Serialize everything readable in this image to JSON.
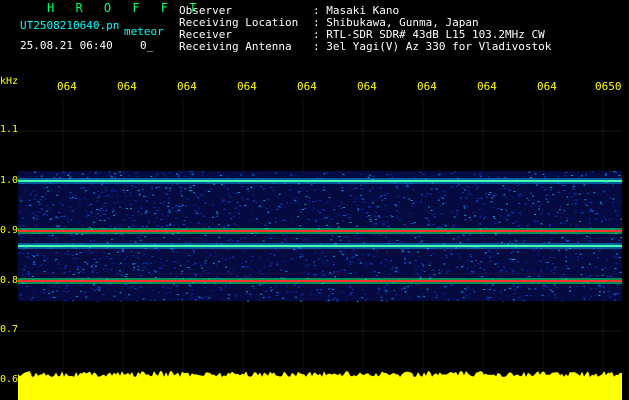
{
  "station": {
    "callsign": "H R O F F T",
    "filename": "UT2508210640.pn",
    "mode": "meteor",
    "date_time": "25.08.21 06:40",
    "counter": "0_"
  },
  "header": {
    "rows": [
      {
        "label": "Observer",
        "value": ": Masaki Kano"
      },
      {
        "label": "Receiving Location",
        "value": ": Shibukawa, Gunma, Japan"
      },
      {
        "label": "Receiver",
        "value": ": RTL-SDR SDR# 43dB L15 103.2MHz CW"
      },
      {
        "label": "Receiving Antenna",
        "value": ": 3el Yagi(V) Az 330 for Vladivostok"
      }
    ]
  },
  "axis": {
    "unit": "kHz",
    "time_ticks": [
      "064",
      "064",
      "064",
      "064",
      "064",
      "064",
      "064",
      "064",
      "064",
      "0650"
    ],
    "freq_ticks": [
      "1.1",
      "1.0",
      "0.9",
      "0.8",
      "0.7",
      "0.6"
    ]
  },
  "spectrogram": {
    "signal_bands_khz": [
      1.0,
      0.9,
      0.87,
      0.8
    ],
    "colors": {
      "background": "#000000",
      "noise": "#0a1a8c",
      "signal": "#ff3030",
      "signal_edge": "#00ff66",
      "baseline": "#ffff00"
    }
  }
}
